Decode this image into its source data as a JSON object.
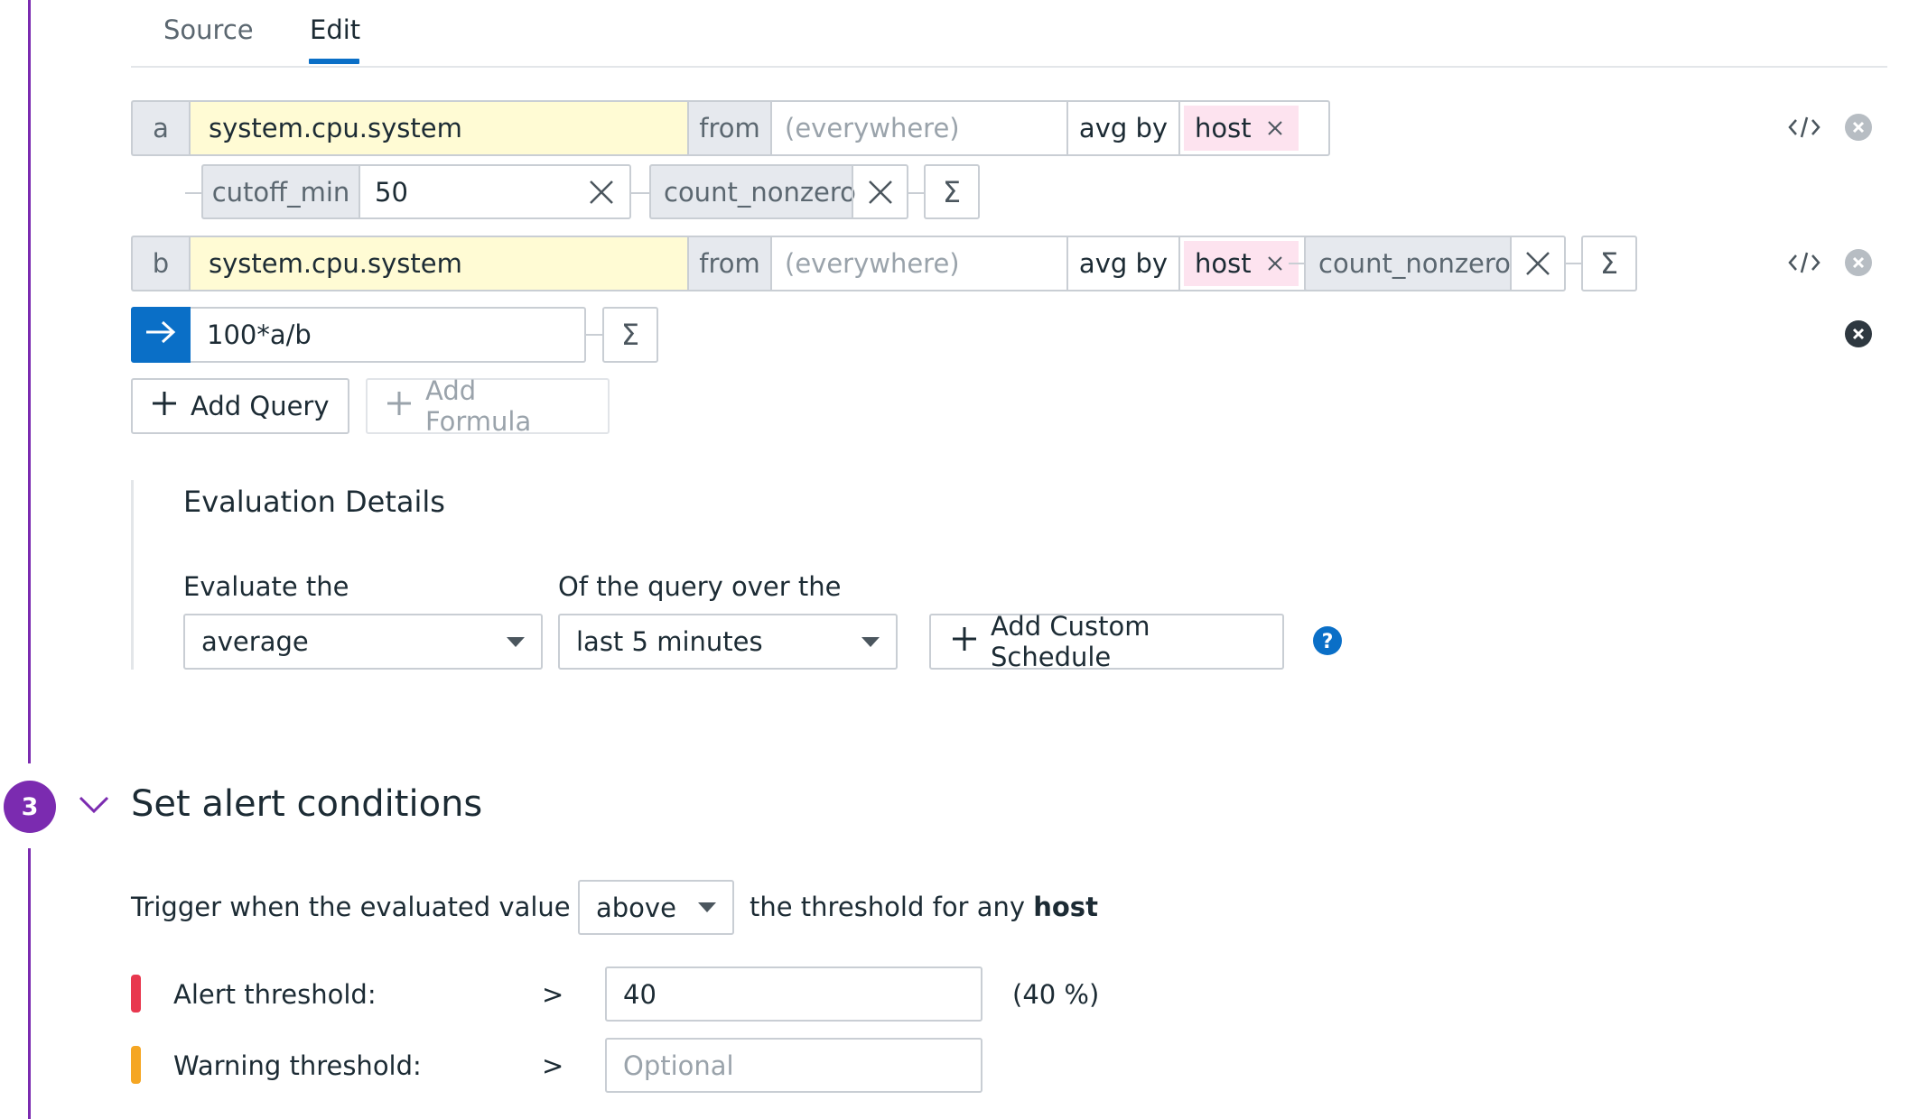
{
  "tabs": {
    "source": "Source",
    "edit": "Edit"
  },
  "query_a": {
    "letter": "a",
    "metric": "system.cpu.system",
    "from_label": "from",
    "from_placeholder": "(everywhere)",
    "agg": "avg by",
    "group_tag": "host",
    "function1": {
      "name": "cutoff_min",
      "value": "50"
    },
    "function2": {
      "name": "count_nonzero"
    }
  },
  "query_b": {
    "letter": "b",
    "metric": "system.cpu.system",
    "from_label": "from",
    "from_placeholder": "(everywhere)",
    "agg": "avg by",
    "group_tag": "host",
    "function1": {
      "name": "count_nonzero"
    }
  },
  "formula": {
    "value": "100*a/b"
  },
  "sigma_symbol": "Σ",
  "buttons": {
    "add_query": "Add Query",
    "add_formula": "Add Formula",
    "add_custom_schedule": "Add Custom Schedule"
  },
  "evaluation": {
    "title": "Evaluation Details",
    "evaluate_label": "Evaluate the",
    "evaluate_value": "average",
    "window_label": "Of the query over the",
    "window_value": "last 5 minutes"
  },
  "alert_section": {
    "step": "3",
    "title": "Set alert conditions",
    "trigger_prefix": "Trigger when the evaluated value is",
    "trigger_value": "above",
    "trigger_suffix": "the threshold for any",
    "trigger_group": "host",
    "alert_label": "Alert threshold:",
    "alert_op": ">",
    "alert_value": "40",
    "alert_pct": "(40 %)",
    "warning_label": "Warning threshold:",
    "warning_op": ">",
    "warning_placeholder": "Optional"
  },
  "colors": {
    "accent": "#0a6fc7",
    "purple": "#7b2bb0",
    "alert": "#e8384f",
    "warning": "#f5a623",
    "metric_bg": "#fffbd4",
    "tag_bg": "#fde3ef"
  },
  "icons": [
    "close-x-icon",
    "sigma-icon",
    "code-icon",
    "remove-circle-icon",
    "arrow-right-icon",
    "plus-icon",
    "chevron-down-icon",
    "help-icon",
    "caret-down-icon"
  ]
}
